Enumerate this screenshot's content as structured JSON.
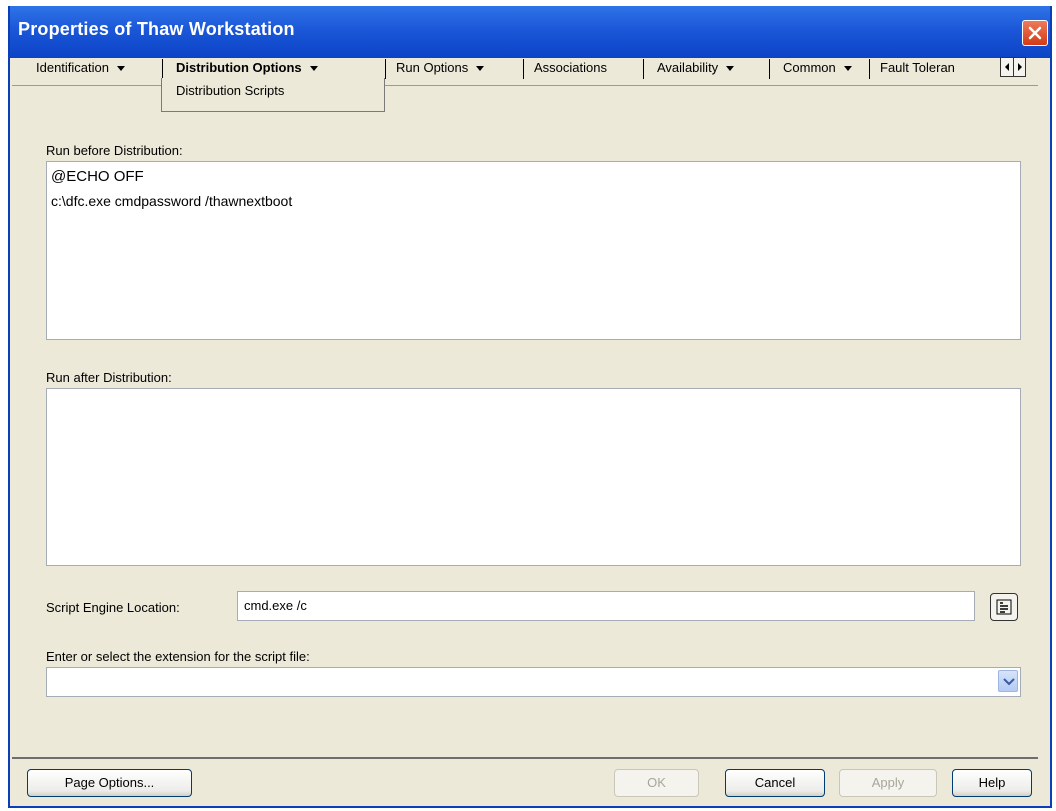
{
  "window": {
    "title": "Properties of Thaw Workstation"
  },
  "tabs": [
    {
      "label": "Identification",
      "has_menu": true
    },
    {
      "label": "Distribution Options",
      "has_menu": true,
      "active": true
    },
    {
      "label": "Run Options",
      "has_menu": true
    },
    {
      "label": "Associations",
      "has_menu": false
    },
    {
      "label": "Availability",
      "has_menu": true
    },
    {
      "label": "Common",
      "has_menu": true
    },
    {
      "label": "Fault Toleran",
      "has_menu": false
    }
  ],
  "dropdown": {
    "items": [
      "Distribution Scripts"
    ]
  },
  "form": {
    "run_before_label": "Run before Distribution:",
    "run_before_lines": [
      "@ECHO OFF",
      "c:\\dfc.exe cmdpassword /thawnextboot"
    ],
    "run_after_label": "Run after Distribution:",
    "run_after_value": "",
    "script_engine_label": "Script Engine Location:",
    "script_engine_value": "cmd.exe /c",
    "extension_label": "Enter or select the extension for the script file:",
    "extension_value": ""
  },
  "buttons": {
    "page_options": "Page Options...",
    "ok": "OK",
    "cancel": "Cancel",
    "apply": "Apply",
    "help": "Help"
  },
  "colors": {
    "titlebar": "#1b57d8",
    "window_bg": "#ece9d8",
    "close_button": "#d23c14"
  }
}
